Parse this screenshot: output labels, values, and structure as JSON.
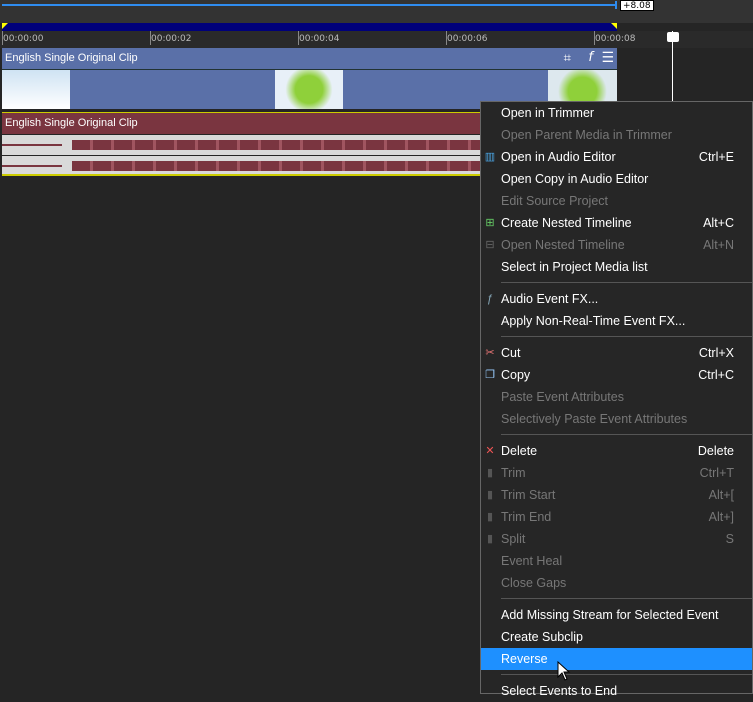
{
  "timeline": {
    "offset_label": "+8.08",
    "ticks": [
      "00:00:00",
      "00:00:02",
      "00:00:04",
      "00:00:06",
      "00:00:08"
    ],
    "video_event_title": "English Single Original Clip",
    "audio_event_title": "English Single Original Clip"
  },
  "menu": {
    "items": [
      {
        "label": "Open in Trimmer",
        "shortcut": "",
        "disabled": false
      },
      {
        "label": "Open Parent Media in Trimmer",
        "shortcut": "",
        "disabled": true
      },
      {
        "label": "Open in Audio Editor",
        "shortcut": "Ctrl+E",
        "disabled": false,
        "icon": "audio-editor-icon"
      },
      {
        "label": "Open Copy in Audio Editor",
        "shortcut": "",
        "disabled": false
      },
      {
        "label": "Edit Source Project",
        "shortcut": "",
        "disabled": true
      },
      {
        "label": "Create Nested Timeline",
        "shortcut": "Alt+C",
        "disabled": false,
        "icon": "nested-timeline-add-icon"
      },
      {
        "label": "Open Nested Timeline",
        "shortcut": "Alt+N",
        "disabled": true,
        "icon": "nested-timeline-icon"
      },
      {
        "label": "Select in Project Media list",
        "shortcut": "",
        "disabled": false
      },
      {
        "sep": true
      },
      {
        "label": "Audio Event FX...",
        "shortcut": "",
        "disabled": false,
        "icon": "fx-icon"
      },
      {
        "label": "Apply Non-Real-Time Event FX...",
        "shortcut": "",
        "disabled": false
      },
      {
        "sep": true
      },
      {
        "label": "Cut",
        "shortcut": "Ctrl+X",
        "disabled": false,
        "icon": "scissors-icon"
      },
      {
        "label": "Copy",
        "shortcut": "Ctrl+C",
        "disabled": false,
        "icon": "copy-icon"
      },
      {
        "label": "Paste Event Attributes",
        "shortcut": "",
        "disabled": true
      },
      {
        "label": "Selectively Paste Event Attributes",
        "shortcut": "",
        "disabled": true
      },
      {
        "sep": true
      },
      {
        "label": "Delete",
        "shortcut": "Delete",
        "disabled": false,
        "icon": "delete-x-icon"
      },
      {
        "label": "Trim",
        "shortcut": "Ctrl+T",
        "disabled": true,
        "icon": "trim-icon"
      },
      {
        "label": "Trim Start",
        "shortcut": "Alt+[",
        "disabled": true,
        "icon": "trim-start-icon"
      },
      {
        "label": "Trim End",
        "shortcut": "Alt+]",
        "disabled": true,
        "icon": "trim-end-icon"
      },
      {
        "label": "Split",
        "shortcut": "S",
        "disabled": true,
        "icon": "split-icon"
      },
      {
        "label": "Event Heal",
        "shortcut": "",
        "disabled": true
      },
      {
        "label": "Close Gaps",
        "shortcut": "",
        "disabled": true
      },
      {
        "sep": true
      },
      {
        "label": "Add Missing Stream for Selected Event",
        "shortcut": "",
        "disabled": false
      },
      {
        "label": "Create Subclip",
        "shortcut": "",
        "disabled": false
      },
      {
        "label": "Reverse",
        "shortcut": "",
        "disabled": false,
        "highlighted": true
      },
      {
        "sep": true
      },
      {
        "label": "Select Events to End",
        "shortcut": "",
        "disabled": false
      }
    ]
  },
  "colors": {
    "accent": "#1e90ff",
    "video_event": "#5a70a8",
    "audio_event": "#7a3540"
  }
}
